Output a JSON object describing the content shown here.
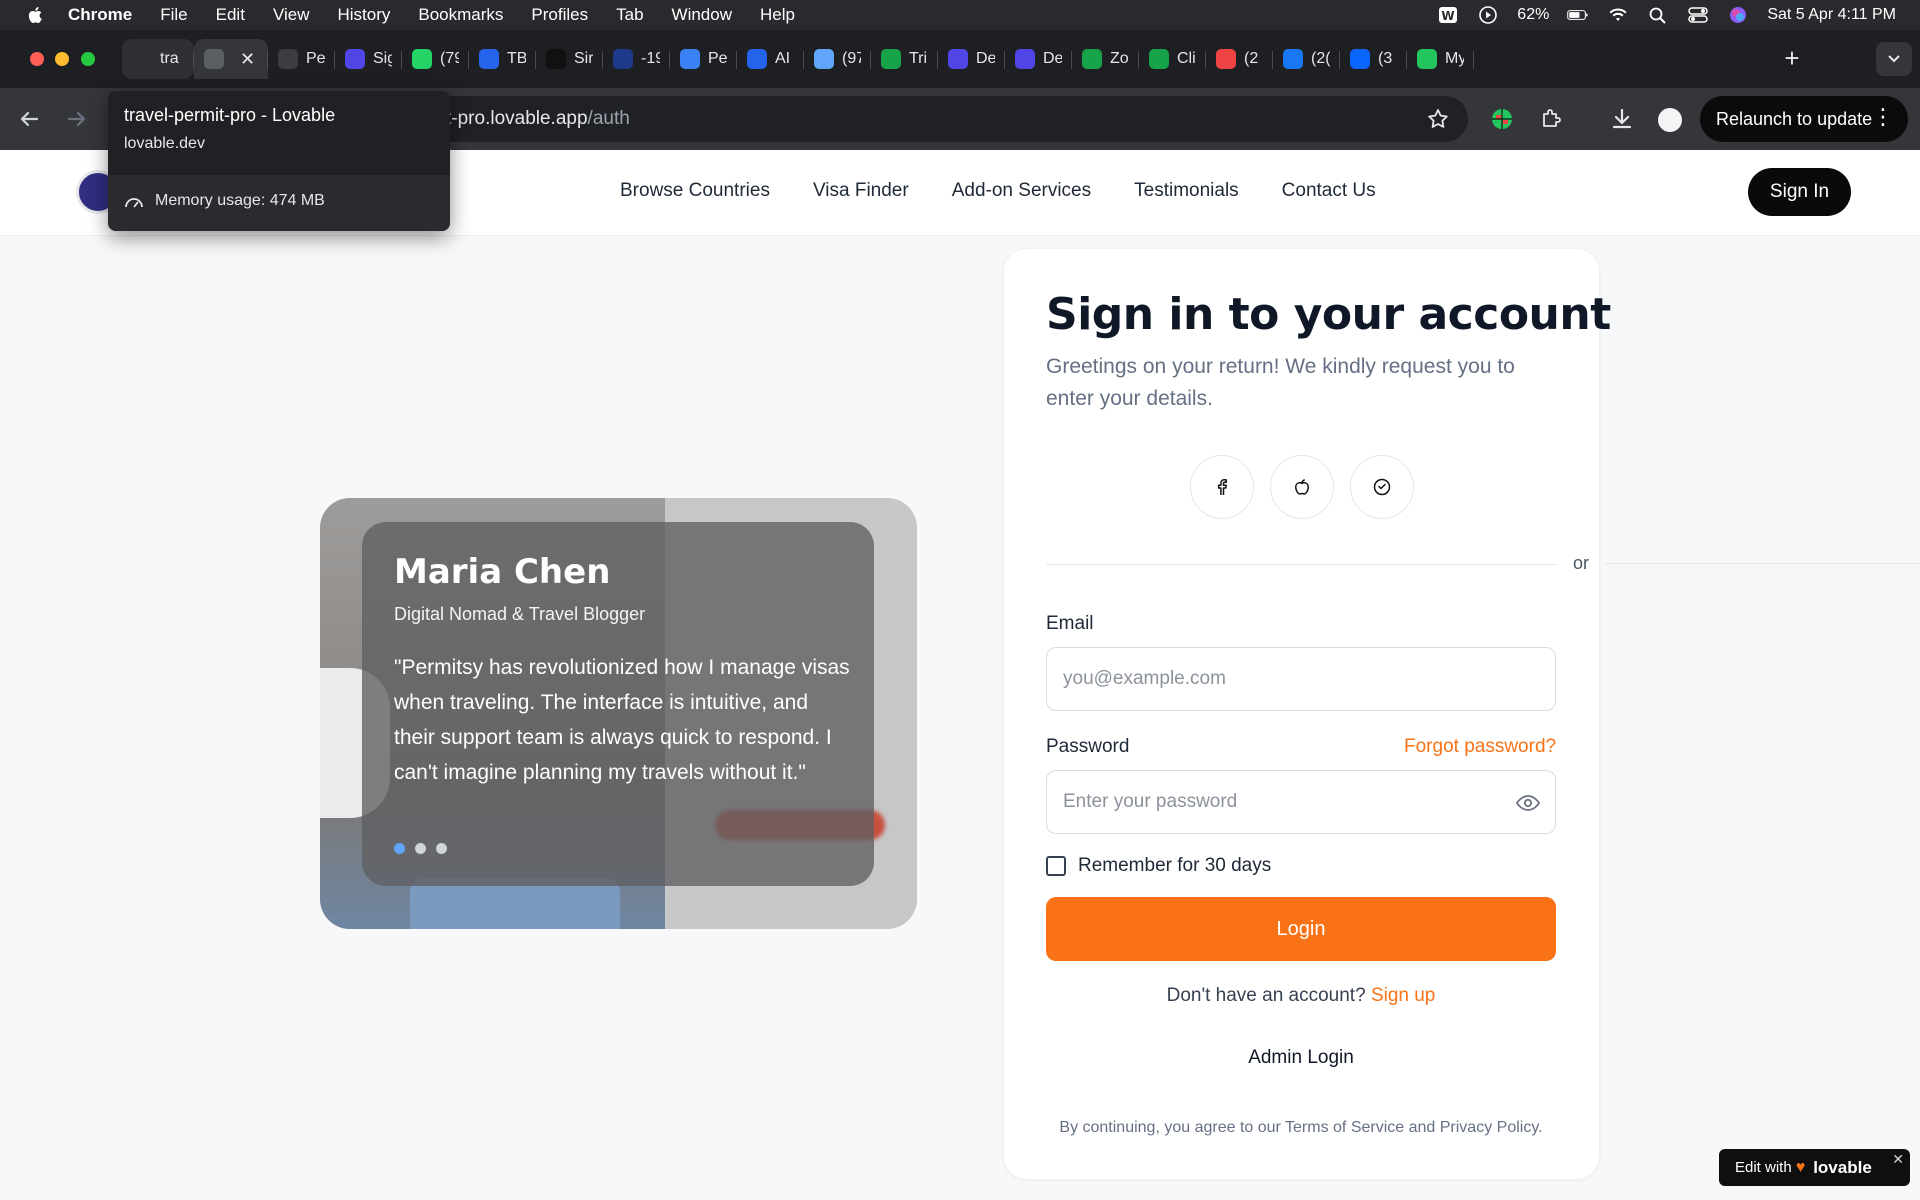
{
  "menubar": {
    "items": [
      "Chrome",
      "File",
      "Edit",
      "View",
      "History",
      "Bookmarks",
      "Profiles",
      "Tab",
      "Window",
      "Help"
    ],
    "battery": "62%",
    "datetime": "Sat 5 Apr  4:11 PM"
  },
  "tabs": [
    {
      "title": "tra",
      "color": "#2f3033"
    },
    {
      "title": "",
      "color": "#5b5e63"
    },
    {
      "title": "Pe",
      "color": "#3b3d42"
    },
    {
      "title": "Sig",
      "color": "#4f46e5"
    },
    {
      "title": "(79",
      "color": "#25d366"
    },
    {
      "title": "TB",
      "color": "#2563eb"
    },
    {
      "title": "Sir",
      "color": "#111111"
    },
    {
      "title": "-19",
      "color": "#1e3a8a"
    },
    {
      "title": "Pe",
      "color": "#3b82f6"
    },
    {
      "title": "AI",
      "color": "#2563eb"
    },
    {
      "title": "(97",
      "color": "#60a5fa"
    },
    {
      "title": "Tri",
      "color": "#16a34a"
    },
    {
      "title": "De",
      "color": "#4f46e5"
    },
    {
      "title": "De",
      "color": "#4f46e5"
    },
    {
      "title": "Zo",
      "color": "#16a34a"
    },
    {
      "title": "Cli",
      "color": "#16a34a"
    },
    {
      "title": "(2",
      "color": "#ef4444"
    },
    {
      "title": "(2(",
      "color": "#1877f2"
    },
    {
      "title": "(3",
      "color": "#0866ff"
    },
    {
      "title": "My",
      "color": "#22c55e"
    }
  ],
  "tooltip": {
    "title": "travel-permit-pro - Lovable",
    "domain": "lovable.dev",
    "memory": "Memory usage: 474 MB"
  },
  "address": {
    "url_host": "t-pro.lovable.app",
    "url_path": "/auth"
  },
  "toolbar": {
    "relaunch_label": "Relaunch to update"
  },
  "site": {
    "nav": [
      "Browse Countries",
      "Visa Finder",
      "Add-on Services",
      "Testimonials",
      "Contact Us"
    ],
    "signin_label": "Sign In"
  },
  "testimonial": {
    "name": "Maria Chen",
    "role": "Digital Nomad & Travel Blogger",
    "quote": "\"Permitsy has revolutionized how I manage visas when traveling. The interface is intuitive, and their support team is always quick to respond. I can't imagine planning my travels without it.\"",
    "dots": 3,
    "active_dot": 0
  },
  "signin": {
    "title": "Sign in to your account",
    "subtitle": "Greetings on your return! We kindly request you to enter your details.",
    "social": [
      "facebook-icon",
      "apple-icon",
      "github-icon"
    ],
    "or": "or",
    "email_label": "Email",
    "email_placeholder": "you@example.com",
    "password_label": "Password",
    "forgot": "Forgot password?",
    "password_placeholder": "Enter your password",
    "remember": "Remember for 30 days",
    "login": "Login",
    "no_account": "Don't have an account?",
    "signup": "Sign up",
    "admin": "Admin Login",
    "terms": "By continuing, you agree to our Terms of Service and Privacy Policy."
  },
  "badge": {
    "edit_with": "Edit with",
    "brand": "lovable"
  },
  "colors": {
    "accent": "#f97316",
    "dark": "#0a0a0a"
  }
}
